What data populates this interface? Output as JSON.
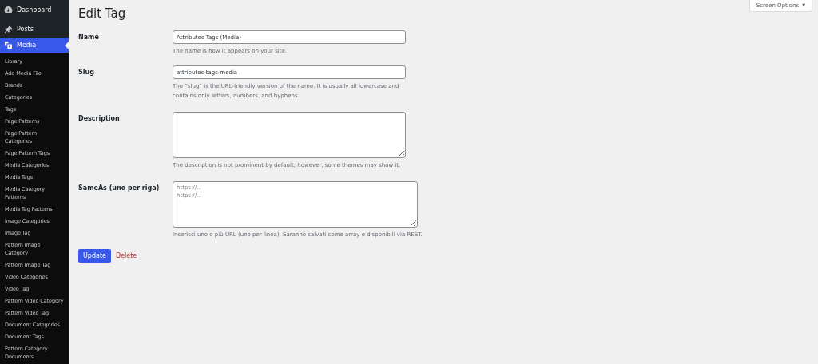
{
  "sidebar": {
    "menu": [
      {
        "label": "Dashboard",
        "selected": false
      },
      {
        "label": "Posts",
        "selected": false
      },
      {
        "label": "Media",
        "selected": true
      }
    ],
    "submenu": [
      "Library",
      "Add Media File",
      "Brands",
      "Categories",
      "Tags",
      "Page Patterns",
      "Page Pattern Categories",
      "Page Pattern Tags",
      "Media Categories",
      "Media Tags",
      "Media Category Patterns",
      "Media Tag Patterns",
      "Image Categories",
      "Image Tag",
      "Pattern Image Category",
      "Pattern Image Tag",
      "Video Categories",
      "Video Tag",
      "Pattern Video Category",
      "Pattern Video Tag",
      "Document Categories",
      "Document Tags",
      "Pattern Category Documents"
    ]
  },
  "screen_options": {
    "label": "Screen Options",
    "caret": "▼"
  },
  "title": "Edit Tag",
  "fields": [
    {
      "label": "Name",
      "kind": "input",
      "value": "Attributes Tags (Media)",
      "help": "The name is how it appears on your site."
    },
    {
      "label": "Slug",
      "kind": "input",
      "value": "attributes-tags-media",
      "help": "The “slug” is the URL-friendly version of the name. It is usually all lowercase and contains only letters, numbers, and hyphens."
    },
    {
      "label": "Description",
      "kind": "textarea",
      "help": "The description is not prominent by default; however, some themes may show it."
    },
    {
      "label": "SameAs (uno per riga)",
      "kind": "textarea-wide",
      "placeholder": "https://...\nhttps://...",
      "help": "Inserisci uno o più URL (uno per linea). Saranno salvati come array e disponibili via REST."
    }
  ],
  "actions": {
    "update": "Update",
    "delete": "Delete"
  }
}
